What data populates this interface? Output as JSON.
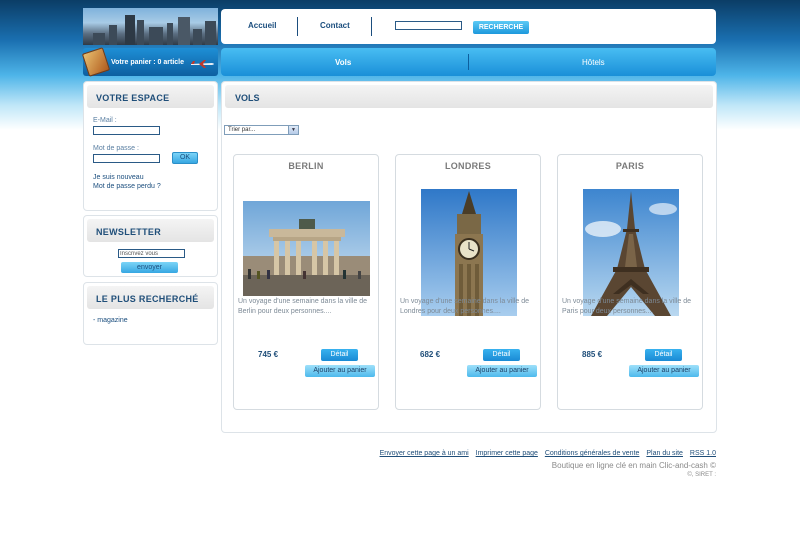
{
  "header": {
    "nav": [
      {
        "label": "Accueil"
      },
      {
        "label": "Contact"
      }
    ],
    "search": {
      "value": "",
      "button": "RECHERCHE"
    },
    "cart": {
      "label": "Votre panier : 0 article"
    },
    "tabs": [
      {
        "label": "Vols",
        "active": true
      },
      {
        "label": "Hôtels",
        "active": false
      }
    ]
  },
  "sidebar": {
    "account": {
      "title": "VOTRE ESPACE",
      "email_label": "E-Mail :",
      "email_value": "",
      "password_label": "Mot de passe :",
      "password_value": "",
      "ok_button": "OK",
      "register_link": "Je suis nouveau",
      "forgot_link": "Mot de passe perdu ?"
    },
    "newsletter": {
      "title": "NEWSLETTER",
      "input_value": "Inscrivez vous",
      "button": "envoyer"
    },
    "popular": {
      "title": "LE PLUS RECHERCHÉ",
      "items": [
        "- magazine"
      ]
    }
  },
  "main": {
    "title": "VOLS",
    "sort_select": "Trier par...",
    "products": [
      {
        "name": "BERLIN",
        "description": "Un voyage d'une semaine dans la ville de Berlin pour deux personnes....",
        "price": "745 €",
        "detail_button": "Détail",
        "cart_button": "Ajouter au panier"
      },
      {
        "name": "LONDRES",
        "description": "Un voyage d'une semaine dans la ville de Londres pour deux personnes....",
        "price": "682 €",
        "detail_button": "Détail",
        "cart_button": "Ajouter au panier"
      },
      {
        "name": "PARIS",
        "description": "Un voyage d'une semaine dans la ville de Paris pour deux personnes....",
        "price": "885 €",
        "detail_button": "Détail",
        "cart_button": "Ajouter au panier"
      }
    ]
  },
  "footer": {
    "links": [
      "Envoyer cette page à un ami",
      "Imprimer cette page",
      "Conditions générales de vente",
      "Plan du site",
      "RSS 1.0"
    ],
    "credit": "Boutique en ligne clé en main Clic-and-cash ©",
    "siret": "©, SIRET :"
  },
  "colors": {
    "accent": "#1a8fd8",
    "heading": "#1f4e79",
    "link": "#1b4e7e"
  }
}
